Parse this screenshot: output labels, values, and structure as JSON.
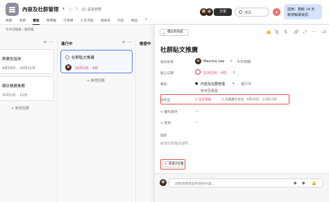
{
  "header": {
    "project_title": "內容及社群管理",
    "set_status": "設定狀態",
    "share_label": "分享",
    "search_placeholder": "搜尋",
    "trial_line1": "試用：剩餘 14 天",
    "trial_line2": "新增帳單資訊"
  },
  "tabs": [
    "概觀",
    "清單",
    "看板",
    "時間軸",
    "行事曆",
    "工作流程",
    "儀表板",
    "訊息",
    "檔案"
  ],
  "board": {
    "breadcrumb": "今天切換版 / 儲存檔",
    "columns": [
      {
        "title": "",
        "cards": [
          {
            "title": "群廣告投放",
            "date": "9月29日 – 10月12日"
          },
          {
            "title": "網店餐廳推薦",
            "date": "10月1日 – 12日"
          }
        ],
        "add_label": "新增任務"
      },
      {
        "title": "進行中",
        "cards": [
          {
            "title": "社群貼文推廣",
            "date": "10月1日 – 4日"
          }
        ],
        "add_label": "新增任務"
      },
      {
        "title": "檢查中",
        "cards": [],
        "add_label": ""
      }
    ]
  },
  "detail": {
    "mark_complete": "標記為完成",
    "title": "社群貼文推廣",
    "assignee_label": "指派對象",
    "assignee_name": "Maurice Lee",
    "assignee_due": "今天到期",
    "due_label": "截止日期",
    "due_value": "10月1日 – 4日",
    "projects_label": "專案",
    "project_name": "內容及社群管理",
    "project_status": "進行中",
    "add_to_project": "新增至專案",
    "dependency_label": "依存度",
    "dependency_waiting": "正在等候",
    "dependency_task": "社群廣告投放",
    "dependency_dates": "· 9月29日 – 10月12日",
    "priority_label": "優先順序",
    "priority_value": "—",
    "progress_label": "階段",
    "progress_value": "—",
    "description_label": "描述",
    "description_placeholder": "新增任務描述說明...",
    "add_subtask": "新增子任務",
    "comment_placeholder": "詢問問題或發佈更新內容..."
  }
}
